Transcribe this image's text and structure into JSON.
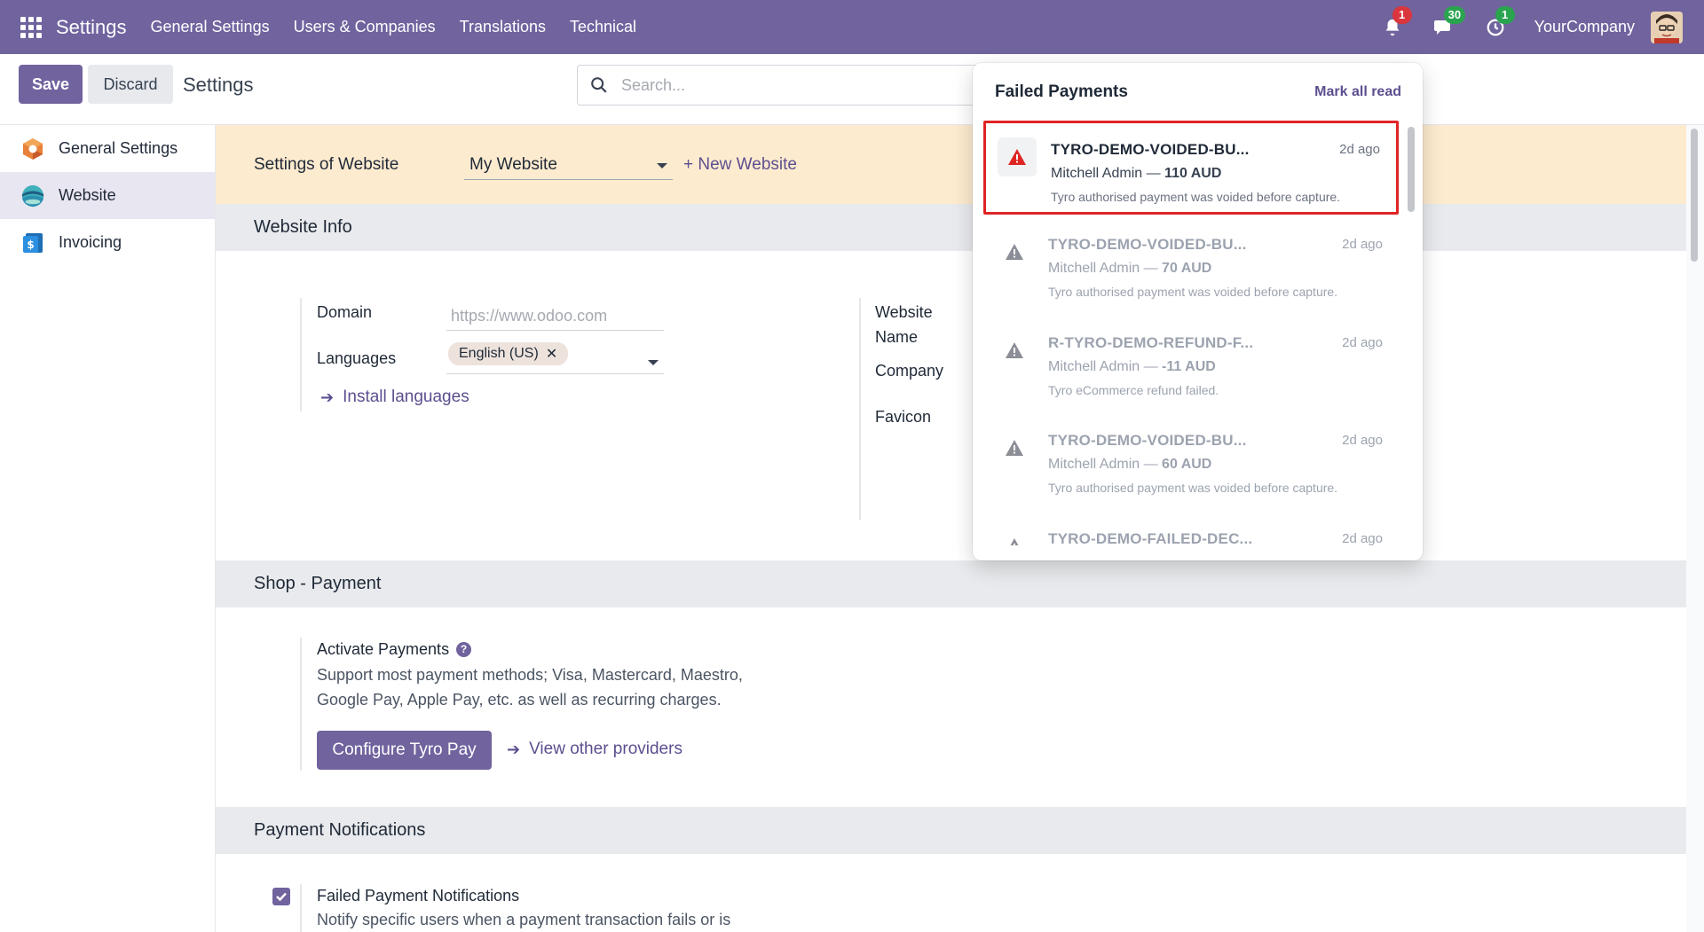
{
  "topbar": {
    "brand": "Settings",
    "menu": [
      "General Settings",
      "Users & Companies",
      "Translations",
      "Technical"
    ],
    "activity_badge": "1",
    "messages_badge": "30",
    "clock_badge": "1",
    "company": "YourCompany"
  },
  "control": {
    "save_label": "Save",
    "discard_label": "Discard",
    "title": "Settings",
    "search_placeholder": "Search..."
  },
  "sidebar": {
    "items": [
      {
        "label": "General Settings",
        "icon": "settings-hexagon-icon"
      },
      {
        "label": "Website",
        "icon": "website-globe-icon"
      },
      {
        "label": "Invoicing",
        "icon": "invoicing-dollar-icon"
      }
    ]
  },
  "website_band": {
    "label": "Settings of Website",
    "selected": "My Website",
    "new_link": "+ New Website"
  },
  "website_info": {
    "heading": "Website Info",
    "domain_label": "Domain",
    "domain_placeholder": "https://www.odoo.com",
    "languages_label": "Languages",
    "language_tag": "English (US)",
    "install_link": "Install languages",
    "website_label_1": "Website",
    "website_label_2": "Name",
    "company_label": "Company",
    "favicon_label": "Favicon"
  },
  "shop_payment": {
    "heading": "Shop - Payment",
    "activate_label": "Activate Payments",
    "desc_line1": "Support most payment methods; Visa, Mastercard, Maestro,",
    "desc_line2": "Google Pay, Apple Pay, etc. as well as recurring charges.",
    "configure_button": "Configure Tyro Pay",
    "other_link": "View other providers"
  },
  "payment_notifications": {
    "heading": "Payment Notifications",
    "failed_label": "Failed Payment Notifications",
    "failed_desc": "Notify specific users when a payment transaction fails or is",
    "checked": true
  },
  "popover": {
    "title": "Failed Payments",
    "mark_all": "Mark all read",
    "items": [
      {
        "title": "TYRO-DEMO-VOIDED-BU...",
        "time": "2d ago",
        "user": "Mitchell Admin —",
        "amount": "110 AUD",
        "message": "Tyro authorised payment was voided before capture."
      },
      {
        "title": "TYRO-DEMO-VOIDED-BU...",
        "time": "2d ago",
        "user": "Mitchell Admin —",
        "amount": "70 AUD",
        "message": "Tyro authorised payment was voided before capture."
      },
      {
        "title": "R-TYRO-DEMO-REFUND-F...",
        "time": "2d ago",
        "user": "Mitchell Admin —",
        "amount": "-11 AUD",
        "message": "Tyro eCommerce refund failed."
      },
      {
        "title": "TYRO-DEMO-VOIDED-BU...",
        "time": "2d ago",
        "user": "Mitchell Admin —",
        "amount": "60 AUD",
        "message": "Tyro authorised payment was voided before capture."
      },
      {
        "title": "TYRO-DEMO-FAILED-DEC...",
        "time": "2d ago",
        "user": "",
        "amount": "",
        "message": ""
      }
    ]
  },
  "colors": {
    "brand": "#71639e",
    "highlight": "#e02424",
    "band": "#fdebcf"
  }
}
